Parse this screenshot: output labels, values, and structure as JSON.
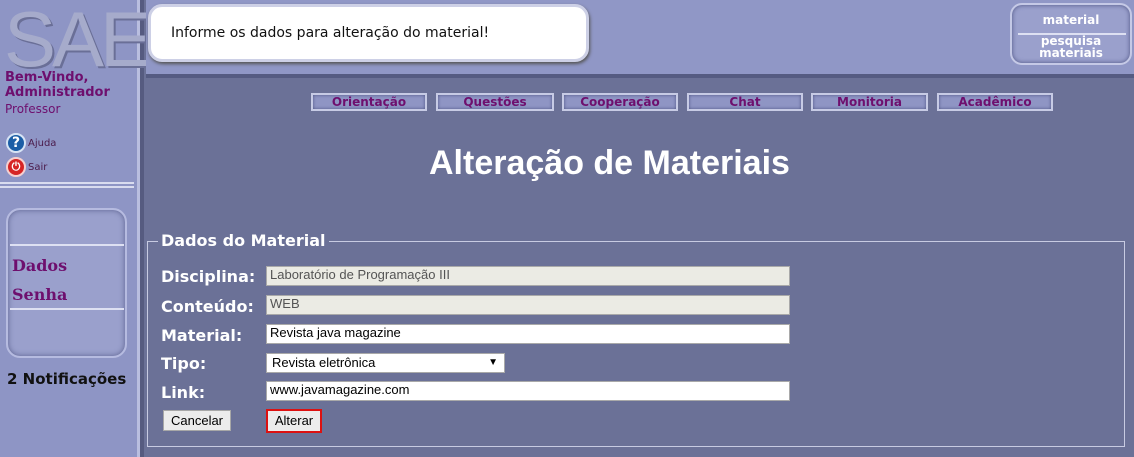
{
  "sidebar": {
    "logo": "SAE",
    "welcome": "Bem-Vindo,",
    "user": "Administrador",
    "role": "Professor",
    "help": "Ajuda",
    "exit": "Sair",
    "menu": [
      "Dados",
      "Senha"
    ],
    "notifications": "2 Notificações"
  },
  "header": {
    "message": "Informe os dados para alteração do material!",
    "nav": {
      "material": "material",
      "search": "pesquisa materiais"
    }
  },
  "tabs": [
    "Orientação",
    "Questões",
    "Cooperação",
    "Chat",
    "Monitoria",
    "Acadêmico"
  ],
  "page_title": "Alteração de Materiais",
  "form": {
    "legend": "Dados do Material",
    "disciplina_label": "Disciplina:",
    "disciplina_value": "Laboratório de Programação III",
    "conteudo_label": "Conteúdo:",
    "conteudo_value": "WEB",
    "material_label": "Material:",
    "material_value": "Revista java magazine",
    "tipo_label": "Tipo:",
    "tipo_value": "Revista eletrônica",
    "link_label": "Link:",
    "link_value": "www.javamagazine.com",
    "cancel": "Cancelar",
    "submit": "Alterar"
  },
  "colors": {
    "brand_purple": "#6e0f6e",
    "sidebar": "#8e95c5",
    "background": "#6b7197"
  }
}
